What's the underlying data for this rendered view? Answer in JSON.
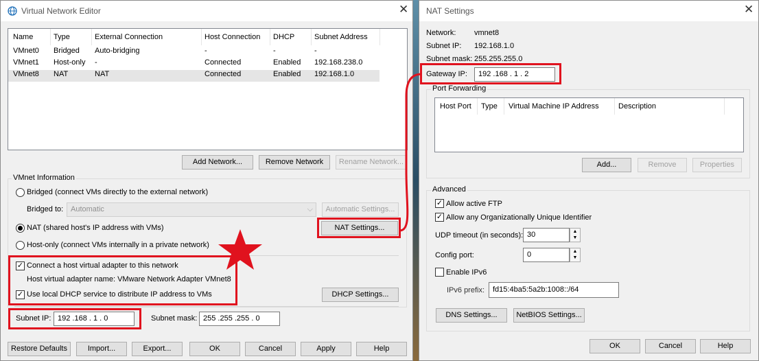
{
  "vne": {
    "title": "Virtual Network Editor",
    "columns": [
      "Name",
      "Type",
      "External Connection",
      "Host Connection",
      "DHCP",
      "Subnet Address"
    ],
    "rows": [
      [
        "VMnet0",
        "Bridged",
        "Auto-bridging",
        "-",
        "-",
        "-"
      ],
      [
        "VMnet1",
        "Host-only",
        "-",
        "Connected",
        "Enabled",
        "192.168.238.0"
      ],
      [
        "VMnet8",
        "NAT",
        "NAT",
        "Connected",
        "Enabled",
        "192.168.1.0"
      ]
    ],
    "add_network": "Add Network...",
    "remove_network": "Remove Network",
    "rename_network": "Rename Network...",
    "vmnet_info": "VMnet Information",
    "bridged_radio": "Bridged (connect VMs directly to the external network)",
    "bridged_to": "Bridged to:",
    "bridged_to_value": "Automatic",
    "auto_settings": "Automatic Settings...",
    "nat_radio": "NAT (shared host's IP address with VMs)",
    "nat_settings": "NAT Settings...",
    "hostonly_radio": "Host-only (connect VMs internally in a private network)",
    "connect_adapter": "Connect a host virtual adapter to this network",
    "adapter_name": "Host virtual adapter name: VMware Network Adapter VMnet8",
    "use_dhcp": "Use local DHCP service to distribute IP address to VMs",
    "dhcp_settings": "DHCP Settings...",
    "subnet_ip_label": "Subnet IP:",
    "subnet_ip": "192 .168 .  1  .  0",
    "subnet_mask_label": "Subnet mask:",
    "subnet_mask": "255 .255 .255 .  0",
    "restore": "Restore Defaults",
    "import": "Import...",
    "export": "Export...",
    "ok": "OK",
    "cancel": "Cancel",
    "apply": "Apply",
    "help": "Help"
  },
  "nat": {
    "title": "NAT Settings",
    "network_label": "Network:",
    "network": "vmnet8",
    "subnet_ip_label": "Subnet IP:",
    "subnet_ip": "192.168.1.0",
    "subnet_mask_label": "Subnet mask:",
    "subnet_mask": "255.255.255.0",
    "gateway_label": "Gateway IP:",
    "gateway": "192 .168 .  1  .  2",
    "port_forwarding": "Port Forwarding",
    "pf_columns": [
      "Host Port",
      "Type",
      "Virtual Machine IP Address",
      "Description"
    ],
    "add": "Add...",
    "remove": "Remove",
    "properties": "Properties",
    "advanced": "Advanced",
    "allow_ftp": "Allow active FTP",
    "allow_oui": "Allow any Organizationally Unique Identifier",
    "udp_label": "UDP timeout (in seconds):",
    "udp": "30",
    "config_port_label": "Config port:",
    "config_port": "0",
    "enable_ipv6": "Enable IPv6",
    "ipv6_label": "IPv6 prefix:",
    "ipv6": "fd15:4ba5:5a2b:1008::/64",
    "dns": "DNS Settings...",
    "netbios": "NetBIOS Settings...",
    "ok": "OK",
    "cancel": "Cancel",
    "help": "Help"
  },
  "colors": {
    "annotation": "#e0121e",
    "window_bg": "#f0f0f0",
    "selection": "#e5e5e5"
  },
  "icons": [
    "globe-icon",
    "close-icon",
    "chevron-down-icon",
    "spin-up-icon",
    "spin-down-icon",
    "star-annotation"
  ]
}
